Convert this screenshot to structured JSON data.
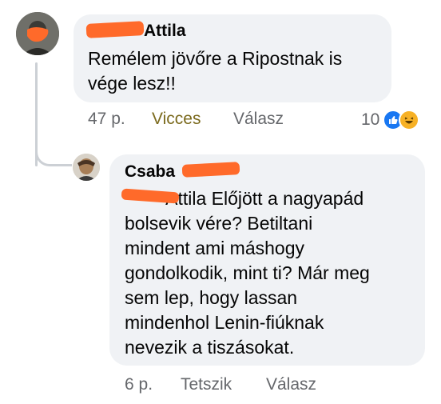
{
  "comment1": {
    "author_visible": "Attila",
    "text": "Remélem jövőre a Ripostnak is\nvége lesz!!",
    "time": "47 p.",
    "reaction_label": "Vicces",
    "reply_label": "Válasz",
    "reaction_count": "10",
    "reaction_icons": [
      "like-icon",
      "haha-icon"
    ]
  },
  "comment2": {
    "author_visible": "Csaba",
    "text": "        Attila Előjött a nagyapád\nbolsevik vére? Betiltani\nmindent ami máshogy\ngondolkodik, mint ti? Már meg\nsem lep, hogy lassan\nmindenhol Lenin-fiúknak\nnevezik a tiszásokat.",
    "time": "6 p.",
    "like_label": "Tetszik",
    "reply_label": "Válasz"
  },
  "colors": {
    "bubble": "#f0f2f5",
    "meta_text": "#65676b",
    "vicces": "#7b6a1d",
    "redaction": "#ff6a2a",
    "like_blue": "#1877f2"
  }
}
